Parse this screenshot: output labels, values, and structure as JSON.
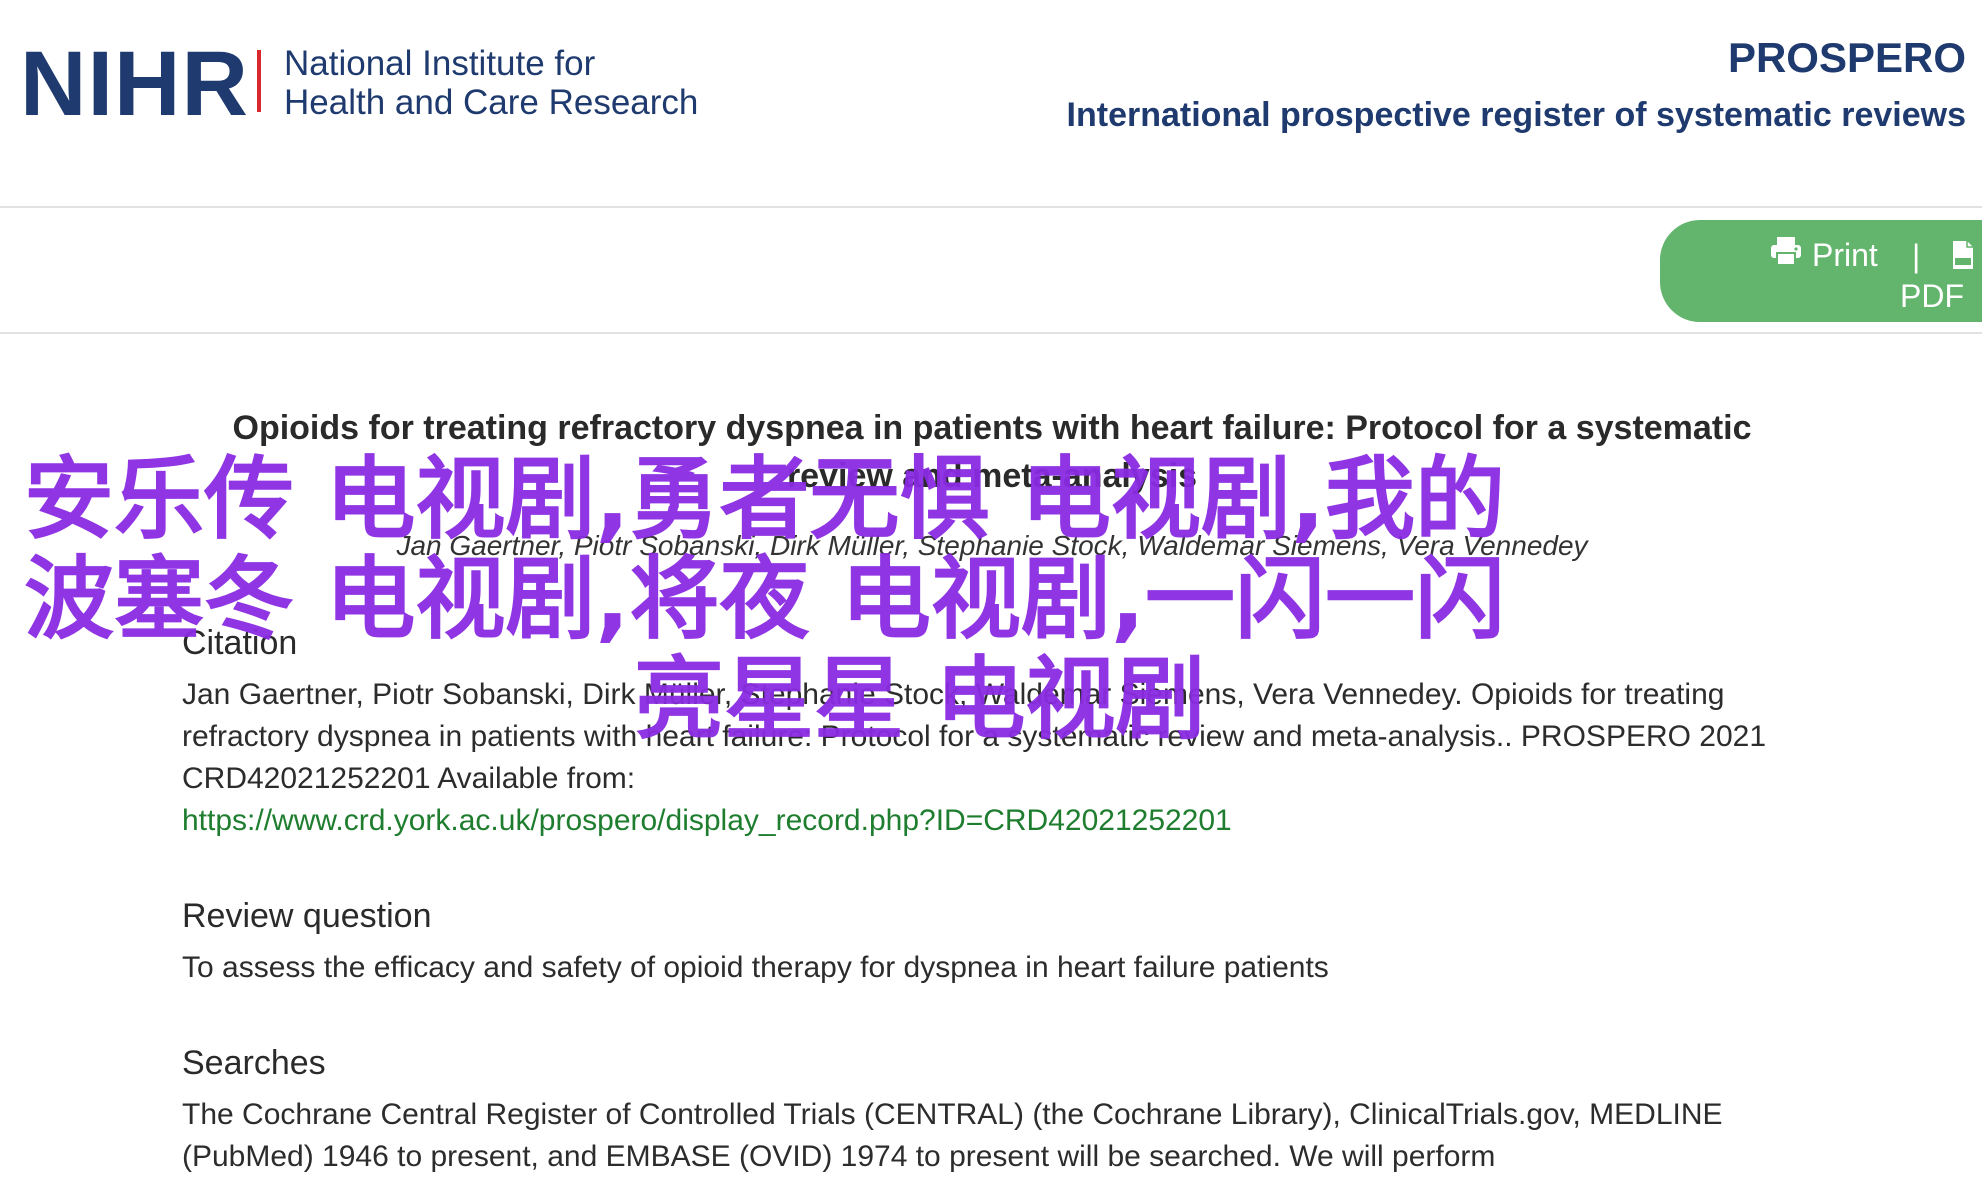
{
  "header": {
    "logo_mark": "NIHR",
    "org_name_line1": "National Institute for",
    "org_name_line2": "Health and Care Research",
    "app_title": "PROSPERO",
    "app_subtitle": "International prospective register of systematic reviews"
  },
  "toolbar": {
    "print_label": "Print",
    "separator": "|",
    "pdf_label": "PDF",
    "accent_color": "#63b46c"
  },
  "record": {
    "title": "Opioids for treating refractory dyspnea in patients with heart failure: Protocol for a systematic review and meta-analysis",
    "authors": "Jan Gaertner, Piotr Sobanski, Dirk Müller, Stephanie Stock, Waldemar Siemens, Vera Vennedey"
  },
  "citation": {
    "heading": "Citation",
    "text": "Jan Gaertner, Piotr Sobanski, Dirk Müller, Stephanie Stock, Waldemar Siemens, Vera Vennedey. Opioids for treating refractory dyspnea in patients with heart failure: Protocol for a systematic review and meta-analysis.. PROSPERO 2021 CRD42021252201 Available from:",
    "link": "https://www.crd.york.ac.uk/prospero/display_record.php?ID=CRD42021252201"
  },
  "review_question": {
    "heading": "Review question",
    "text": "To assess the efficacy and safety of opioid therapy for dyspnea in heart failure patients"
  },
  "searches": {
    "heading": "Searches",
    "text": "The Cochrane Central Register of Controlled Trials (CENTRAL) (the Cochrane Library), ClinicalTrials.gov, MEDLINE (PubMed) 1946 to present, and EMBASE (OVID) 1974 to present will be searched. We will perform"
  },
  "overlay": {
    "line1": "安乐传 电视剧,勇者无惧 电视剧,我的",
    "line2": "波塞冬 电视剧,将夜 电视剧,一闪一闪",
    "line3": "亮星星 电视剧",
    "color": "#8a2be2"
  }
}
